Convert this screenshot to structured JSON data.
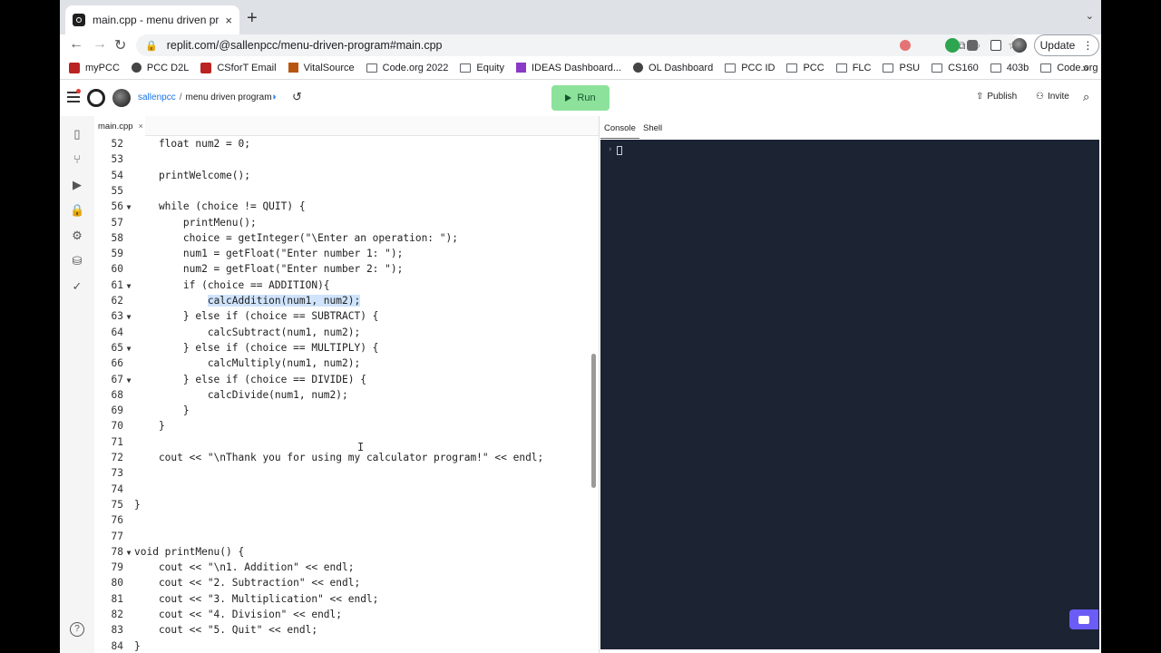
{
  "browser": {
    "tab_title": "main.cpp - menu driven progra",
    "tab_close": "×",
    "new_tab": "+",
    "tab_menu": "⌄",
    "url": "replit.com/@sallenpcc/menu-driven-program#main.cpp",
    "update_label": "Update",
    "update_menu": "⋮",
    "nav_back": "←",
    "nav_forward": "→",
    "nav_reload": "↻",
    "lock_icon": "🔒",
    "bookmarks_more": "»",
    "bookmarks": [
      {
        "label": "myPCC",
        "icon": "red"
      },
      {
        "label": "PCC D2L",
        "icon": "circ"
      },
      {
        "label": "CSforT Email",
        "icon": "red"
      },
      {
        "label": "VitalSource",
        "icon": "v"
      },
      {
        "label": "Code.org 2022",
        "icon": "folder"
      },
      {
        "label": "Equity",
        "icon": "folder"
      },
      {
        "label": "IDEAS Dashboard...",
        "icon": "grid"
      },
      {
        "label": "OL Dashboard",
        "icon": "circ"
      },
      {
        "label": "PCC ID",
        "icon": "folder"
      },
      {
        "label": "PCC",
        "icon": "folder"
      },
      {
        "label": "FLC",
        "icon": "folder"
      },
      {
        "label": "PSU",
        "icon": "folder"
      },
      {
        "label": "CS160",
        "icon": "folder"
      },
      {
        "label": "403b",
        "icon": "folder"
      },
      {
        "label": "Code.org",
        "icon": "folder"
      }
    ]
  },
  "header": {
    "user": "sallenpcc",
    "separator": "/",
    "project": "menu driven program",
    "run_label": "Run",
    "publish_label": "Publish",
    "invite_label": "Invite"
  },
  "editor": {
    "file_tab": "main.cpp",
    "file_tab_close": "×",
    "cursor_glyph": "I",
    "lines": [
      {
        "n": "52",
        "fold": "",
        "text": "    float num2 = 0;"
      },
      {
        "n": "53",
        "fold": "",
        "text": ""
      },
      {
        "n": "54",
        "fold": "",
        "text": "    printWelcome();"
      },
      {
        "n": "55",
        "fold": "",
        "text": ""
      },
      {
        "n": "56",
        "fold": "▼",
        "text": "    while (choice != QUIT) {"
      },
      {
        "n": "57",
        "fold": "",
        "text": "        printMenu();"
      },
      {
        "n": "58",
        "fold": "",
        "text": "        choice = getInteger(\"\\Enter an operation: \");"
      },
      {
        "n": "59",
        "fold": "",
        "text": "        num1 = getFloat(\"Enter number 1: \");"
      },
      {
        "n": "60",
        "fold": "",
        "text": "        num2 = getFloat(\"Enter number 2: \");"
      },
      {
        "n": "61",
        "fold": "▼",
        "text": "        if (choice == ADDITION){"
      },
      {
        "n": "62",
        "fold": "",
        "text": "            calcAddition(num1, num2);",
        "highlight": true
      },
      {
        "n": "63",
        "fold": "▼",
        "text": "        } else if (choice == SUBTRACT) {"
      },
      {
        "n": "64",
        "fold": "",
        "text": "            calcSubtract(num1, num2);"
      },
      {
        "n": "65",
        "fold": "▼",
        "text": "        } else if (choice == MULTIPLY) {"
      },
      {
        "n": "66",
        "fold": "",
        "text": "            calcMultiply(num1, num2);"
      },
      {
        "n": "67",
        "fold": "▼",
        "text": "        } else if (choice == DIVIDE) {"
      },
      {
        "n": "68",
        "fold": "",
        "text": "            calcDivide(num1, num2);"
      },
      {
        "n": "69",
        "fold": "",
        "text": "        }"
      },
      {
        "n": "70",
        "fold": "",
        "text": "    }"
      },
      {
        "n": "71",
        "fold": "",
        "text": ""
      },
      {
        "n": "72",
        "fold": "",
        "text": "    cout << \"\\nThank you for using my calculator program!\" << endl;"
      },
      {
        "n": "73",
        "fold": "",
        "text": ""
      },
      {
        "n": "74",
        "fold": "",
        "text": ""
      },
      {
        "n": "75",
        "fold": "",
        "text": "}"
      },
      {
        "n": "76",
        "fold": "",
        "text": ""
      },
      {
        "n": "77",
        "fold": "",
        "text": ""
      },
      {
        "n": "78",
        "fold": "▼",
        "text": "void printMenu() {"
      },
      {
        "n": "79",
        "fold": "",
        "text": "    cout << \"\\n1. Addition\" << endl;"
      },
      {
        "n": "80",
        "fold": "",
        "text": "    cout << \"2. Subtraction\" << endl;"
      },
      {
        "n": "81",
        "fold": "",
        "text": "    cout << \"3. Multiplication\" << endl;"
      },
      {
        "n": "82",
        "fold": "",
        "text": "    cout << \"4. Division\" << endl;"
      },
      {
        "n": "83",
        "fold": "",
        "text": "    cout << \"5. Quit\" << endl;"
      },
      {
        "n": "84",
        "fold": "",
        "text": "}"
      }
    ]
  },
  "console": {
    "tab_console": "Console",
    "tab_shell": "Shell",
    "prompt": "›"
  },
  "colors": {
    "run_button": "#8de29b",
    "console_bg": "#1c2333",
    "selection": "#cfe3fb",
    "chat_button": "#6b5cf6"
  }
}
